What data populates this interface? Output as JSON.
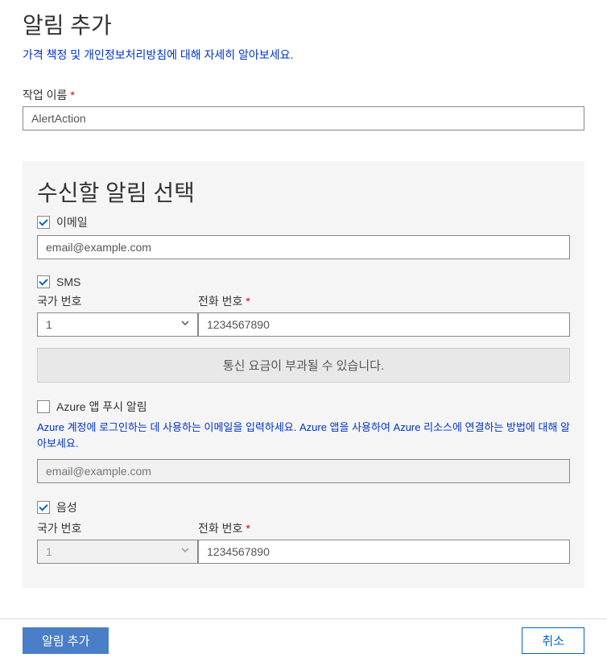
{
  "header": {
    "title": "알림 추가",
    "info_link": "가격 책정 및 개인정보처리방침에 대해 자세히 알아보세요."
  },
  "action_name": {
    "label": "작업 이름",
    "value": "AlertAction"
  },
  "notifications": {
    "panel_title": "수신할 알림 선택",
    "email": {
      "label": "이메일",
      "checked": true,
      "value": "email@example.com"
    },
    "sms": {
      "label": "SMS",
      "checked": true,
      "country_label": "국가 번호",
      "country_value": "1",
      "phone_label": "전화 번호",
      "phone_value": "1234567890",
      "warning": "통신 요금이 부과될 수 있습니다."
    },
    "azure_push": {
      "label": "Azure 앱 푸시 알림",
      "checked": false,
      "help": "Azure 계정에 로그인하는 데 사용하는 이메일을 입력하세요. Azure 앱을 사용하여 Azure 리소스에 연결하는 방법에 대해 알아보세요.",
      "placeholder": "email@example.com"
    },
    "voice": {
      "label": "음성",
      "checked": true,
      "country_label": "국가 번호",
      "country_value": "1",
      "phone_label": "전화 번호",
      "phone_value": "1234567890"
    }
  },
  "footer": {
    "add_button": "알림 추가",
    "cancel_button": "취소"
  }
}
